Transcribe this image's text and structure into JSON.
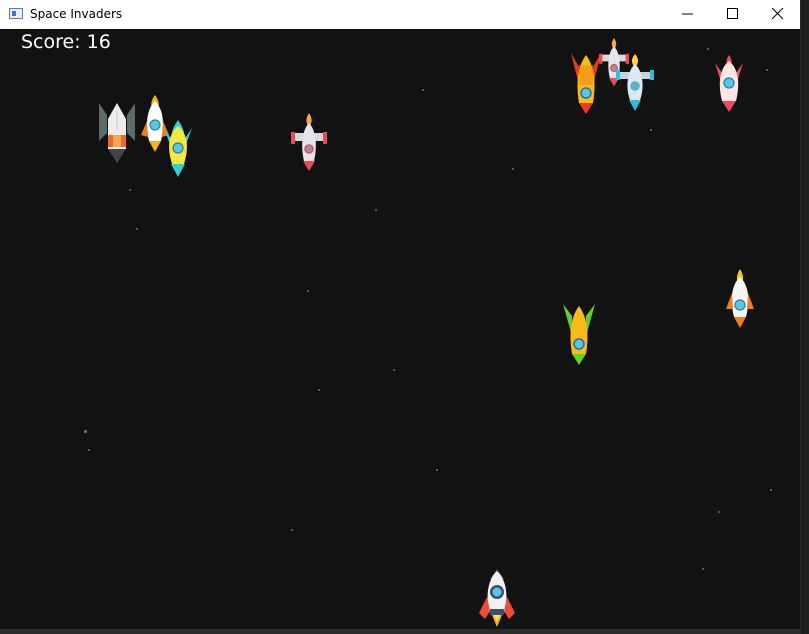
{
  "window": {
    "title": "Space Invaders",
    "controls": {
      "minimize": "minimize-icon",
      "maximize": "maximize-icon",
      "close": "close-icon"
    }
  },
  "hud": {
    "score_text": "Score: 16"
  },
  "player": {
    "icon": "player-rocket"
  },
  "enemies": [
    {
      "type": "grey-missile"
    },
    {
      "type": "orange-rocket"
    },
    {
      "type": "yellow-rocket"
    },
    {
      "type": "silver-fighter"
    },
    {
      "type": "orange-yellow-rocket"
    },
    {
      "type": "silver-fighter"
    },
    {
      "type": "blue-fighter"
    },
    {
      "type": "pink-rocket"
    },
    {
      "type": "white-orange-rocket"
    },
    {
      "type": "green-yellow-rocket"
    }
  ],
  "colors": {
    "background": "#121212",
    "titlebar": "#ffffff",
    "score_text": "#ffffff"
  }
}
